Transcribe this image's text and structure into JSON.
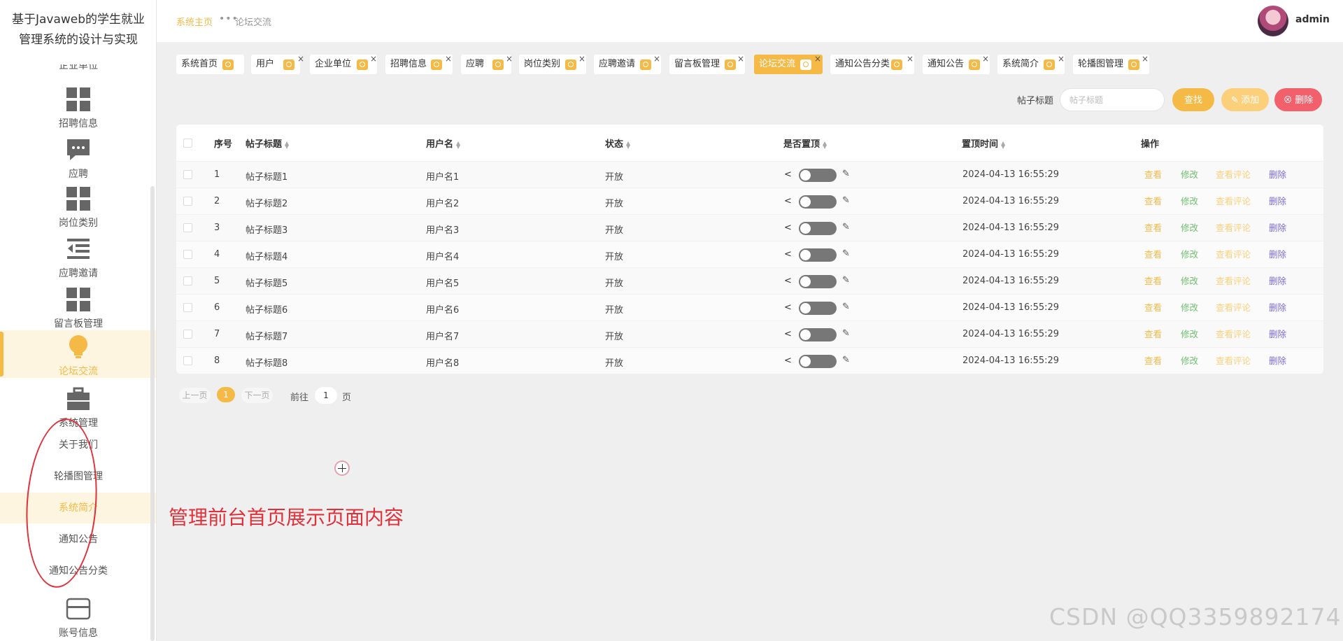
{
  "sidebar": {
    "title_line1": "基于Javaweb的学生就业",
    "title_line2": "管理系统的设计与实现",
    "partial_item": "企业单位",
    "menu": [
      {
        "label": "招聘信息",
        "icon": "grid-icon"
      },
      {
        "label": "应聘",
        "icon": "chat-bubble-icon"
      },
      {
        "label": "岗位类别",
        "icon": "grid-icon"
      },
      {
        "label": "应聘邀请",
        "icon": "indent-list-icon"
      },
      {
        "label": "留言板管理",
        "icon": "grid-icon"
      },
      {
        "label": "论坛交流",
        "icon": "lightbulb-icon",
        "active": true
      },
      {
        "label": "系统管理",
        "icon": "briefcase-icon"
      }
    ],
    "sub_items": [
      {
        "label": "关于我们"
      },
      {
        "label": "轮播图管理"
      },
      {
        "label": "系统简介",
        "active": true
      },
      {
        "label": "通知公告"
      },
      {
        "label": "通知公告分类"
      }
    ],
    "account": {
      "label": "账号信息",
      "icon": "card-icon"
    }
  },
  "header": {
    "breadcrumb_home": "系统主页",
    "breadcrumb_sep": "•••",
    "breadcrumb_current": "论坛交流",
    "username": "admin"
  },
  "tabs": [
    {
      "label": "系统首页",
      "closable": false
    },
    {
      "label": "用户",
      "closable": true
    },
    {
      "label": "企业单位",
      "closable": true
    },
    {
      "label": "招聘信息",
      "closable": true
    },
    {
      "label": "应聘",
      "closable": true
    },
    {
      "label": "岗位类别",
      "closable": true
    },
    {
      "label": "应聘邀请",
      "closable": true
    },
    {
      "label": "留言板管理",
      "closable": true
    },
    {
      "label": "论坛交流",
      "closable": true,
      "active": true
    },
    {
      "label": "通知公告分类",
      "closable": true
    },
    {
      "label": "通知公告",
      "closable": true
    },
    {
      "label": "系统简介",
      "closable": true
    },
    {
      "label": "轮播图管理",
      "closable": true
    }
  ],
  "tab_close_glyph": "×",
  "search": {
    "label": "帖子标题",
    "placeholder": "帖子标题",
    "search_button": "查找",
    "add_button": "添加",
    "delete_button": "删除"
  },
  "table": {
    "columns": [
      "序号",
      "帖子标题",
      "用户名",
      "状态",
      "是否置顶",
      "置顶时间",
      "操作"
    ],
    "rows": [
      {
        "index": "1",
        "title": "帖子标题1",
        "user": "用户名1",
        "status": "开放",
        "time": "2024-04-13 16:55:29"
      },
      {
        "index": "2",
        "title": "帖子标题2",
        "user": "用户名2",
        "status": "开放",
        "time": "2024-04-13 16:55:29"
      },
      {
        "index": "3",
        "title": "帖子标题3",
        "user": "用户名3",
        "status": "开放",
        "time": "2024-04-13 16:55:29"
      },
      {
        "index": "4",
        "title": "帖子标题4",
        "user": "用户名4",
        "status": "开放",
        "time": "2024-04-13 16:55:29"
      },
      {
        "index": "5",
        "title": "帖子标题5",
        "user": "用户名5",
        "status": "开放",
        "time": "2024-04-13 16:55:29"
      },
      {
        "index": "6",
        "title": "帖子标题6",
        "user": "用户名6",
        "status": "开放",
        "time": "2024-04-13 16:55:29"
      },
      {
        "index": "7",
        "title": "帖子标题7",
        "user": "用户名7",
        "status": "开放",
        "time": "2024-04-13 16:55:29"
      },
      {
        "index": "8",
        "title": "帖子标题8",
        "user": "用户名8",
        "status": "开放",
        "time": "2024-04-13 16:55:29"
      }
    ],
    "actions": {
      "view": "查看",
      "edit": "修改",
      "comments": "查看评论",
      "delete": "删除"
    }
  },
  "pagination": {
    "prev": "上一页",
    "current": "1",
    "next": "下一页",
    "goto_label": "前往",
    "goto_value": "1",
    "page_suffix": "页"
  },
  "annotation": "管理前台首页展示页面内容",
  "watermark": "CSDN @QQ3359892174",
  "colors": {
    "accent": "#f5b946",
    "edit": "#6ec06e",
    "delete_button": "#f2606c",
    "delete_link": "#7d6bd8",
    "annotation": "#e0303a"
  }
}
